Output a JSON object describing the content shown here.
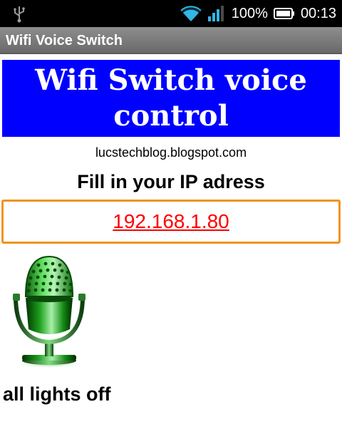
{
  "status_bar": {
    "battery_percent": "100%",
    "time": "00:13",
    "icons": [
      "usb-icon",
      "wifi-icon",
      "signal-icon",
      "battery-icon"
    ]
  },
  "app_bar": {
    "title": "Wifi Voice Switch"
  },
  "banner": {
    "line1": "Wifi Switch voice",
    "line2": "control",
    "background_color": "#0000ff"
  },
  "main": {
    "blog_url": "lucstechblog.blogspot.com",
    "ip_label": "Fill in your IP adress",
    "ip_value": "192.168.1.80",
    "mic_icon": "microphone-icon",
    "status_text": "all lights off"
  },
  "colors": {
    "input_border": "#f0941e",
    "ip_text": "#ff0000",
    "accent_wifi": "#33b5e5"
  }
}
